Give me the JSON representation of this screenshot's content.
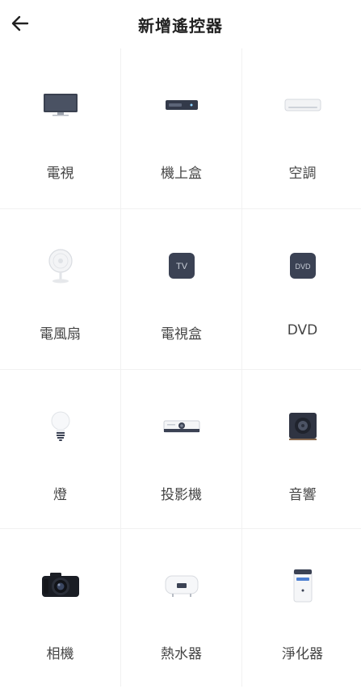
{
  "header": {
    "title": "新增遙控器"
  },
  "devices": [
    {
      "label": "電視",
      "icon": "tv-icon"
    },
    {
      "label": "機上盒",
      "icon": "set-top-box-icon"
    },
    {
      "label": "空調",
      "icon": "air-conditioner-icon"
    },
    {
      "label": "電風扇",
      "icon": "fan-icon"
    },
    {
      "label": "電視盒",
      "icon": "tv-box-icon",
      "badge": "TV"
    },
    {
      "label": "DVD",
      "icon": "dvd-icon",
      "badge": "DVD"
    },
    {
      "label": "燈",
      "icon": "light-bulb-icon"
    },
    {
      "label": "投影機",
      "icon": "projector-icon"
    },
    {
      "label": "音響",
      "icon": "speaker-icon"
    },
    {
      "label": "相機",
      "icon": "camera-icon"
    },
    {
      "label": "熱水器",
      "icon": "water-heater-icon"
    },
    {
      "label": "淨化器",
      "icon": "air-purifier-icon"
    }
  ]
}
